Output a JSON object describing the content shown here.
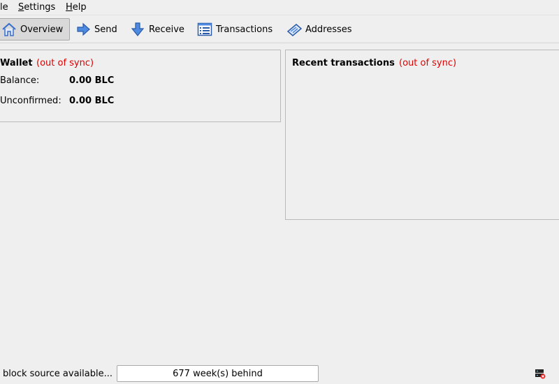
{
  "menubar": {
    "items": [
      {
        "label": "le",
        "underline": ""
      },
      {
        "label": "Settings",
        "underline": "S"
      },
      {
        "label": "Help",
        "underline": "H"
      }
    ]
  },
  "toolbar": {
    "buttons": [
      {
        "label": "Overview",
        "icon": "home-icon",
        "active": true
      },
      {
        "label": "Send",
        "icon": "send-arrow-icon",
        "active": false
      },
      {
        "label": "Receive",
        "icon": "receive-arrow-icon",
        "active": false
      },
      {
        "label": "Transactions",
        "icon": "transactions-list-icon",
        "active": false
      },
      {
        "label": "Addresses",
        "icon": "address-book-icon",
        "active": false
      }
    ]
  },
  "wallet": {
    "title": "Wallet",
    "sync_status": "(out of sync)",
    "balance_label": "Balance:",
    "balance_value": "0.00 BLC",
    "unconfirmed_label": "Unconfirmed:",
    "unconfirmed_value": "0.00 BLC"
  },
  "recent": {
    "title": "Recent transactions",
    "sync_status": "(out of sync)"
  },
  "status": {
    "message": "block source available...",
    "progress_text": "677 week(s) behind",
    "network_icon": "network-disconnected-icon"
  },
  "colors": {
    "warning": "#e00000",
    "background": "#efefef",
    "icon_blue": "#3a6fc9"
  }
}
